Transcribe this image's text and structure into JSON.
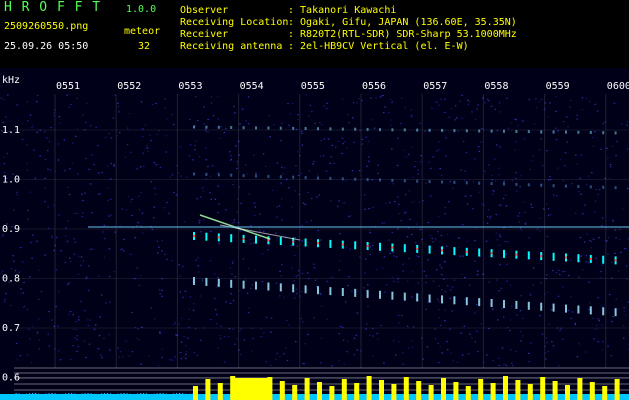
{
  "app": {
    "name": "H R O F F T",
    "version": "1.0.0"
  },
  "file": {
    "name": "2509260550.png",
    "datetime": "25.09.26 05:50"
  },
  "meteor": {
    "label": "meteor",
    "count": "32"
  },
  "info": [
    {
      "key": "Observer",
      "value": ": Takanori Kawachi"
    },
    {
      "key": "Receiving Location",
      "value": ": Ogaki, Gifu, JAPAN (136.60E, 35.35N)"
    },
    {
      "key": "Receiver",
      "value": ": R820T2(RTL-SDR) SDR-Sharp 53.1000MHz"
    },
    {
      "key": "Receiving antenna",
      "value": ": 2el-HB9CV Vertical (el. E-W)"
    }
  ],
  "axis": {
    "unit": "kHz",
    "time_ticks": [
      "0551",
      "0552",
      "0553",
      "0554",
      "0555",
      "0556",
      "0557",
      "0558",
      "0559",
      "0600"
    ],
    "freq_ticks": [
      "1.1",
      "1.0",
      "0.9",
      "0.8",
      "0.7",
      "0.6"
    ]
  },
  "colors": {
    "background": "#000000",
    "header_text": "#ffff00",
    "app_title": "#55ff55",
    "trace": "#00ffff",
    "bars": "#ffff00",
    "grid": "#ffffff"
  }
}
